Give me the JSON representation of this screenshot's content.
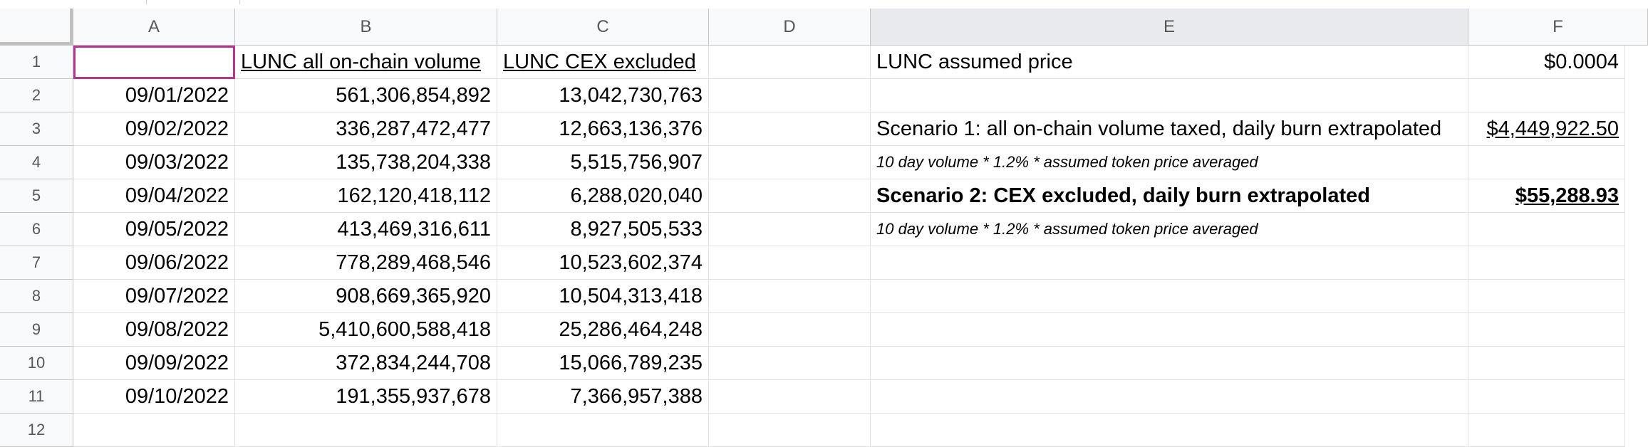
{
  "column_headers": [
    "A",
    "B",
    "C",
    "D",
    "E",
    "F"
  ],
  "row_headers": [
    "1",
    "2",
    "3",
    "4",
    "5",
    "6",
    "7",
    "8",
    "9",
    "10",
    "11",
    "12"
  ],
  "cells": {
    "B1": "LUNC all on-chain volume",
    "C1": "LUNC CEX excluded",
    "E1": "LUNC assumed price",
    "F1": "$0.0004",
    "E3": "Scenario 1: all on-chain volume taxed, daily burn extrapolated",
    "F3": "$4,449,922.50",
    "E4": "10 day volume * 1.2% * assumed token price averaged",
    "E5": "Scenario 2: CEX excluded, daily burn extrapolated",
    "F5": "$55,288.93",
    "E6": "10 day volume * 1.2% * assumed token price averaged"
  },
  "rows": [
    {
      "date": "09/01/2022",
      "all_volume": "561,306,854,892",
      "cex_excluded": "13,042,730,763"
    },
    {
      "date": "09/02/2022",
      "all_volume": "336,287,472,477",
      "cex_excluded": "12,663,136,376"
    },
    {
      "date": "09/03/2022",
      "all_volume": "135,738,204,338",
      "cex_excluded": "5,515,756,907"
    },
    {
      "date": "09/04/2022",
      "all_volume": "162,120,418,112",
      "cex_excluded": "6,288,020,040"
    },
    {
      "date": "09/05/2022",
      "all_volume": "413,469,316,611",
      "cex_excluded": "8,927,505,533"
    },
    {
      "date": "09/06/2022",
      "all_volume": "778,289,468,546",
      "cex_excluded": "10,523,602,374"
    },
    {
      "date": "09/07/2022",
      "all_volume": "908,669,365,920",
      "cex_excluded": "10,504,313,418"
    },
    {
      "date": "09/08/2022",
      "all_volume": "5,410,600,588,418",
      "cex_excluded": "25,286,464,248"
    },
    {
      "date": "09/09/2022",
      "all_volume": "372,834,244,708",
      "cex_excluded": "15,066,789,235"
    },
    {
      "date": "09/10/2022",
      "all_volume": "191,355,937,678",
      "cex_excluded": "7,366,957,388"
    }
  ]
}
